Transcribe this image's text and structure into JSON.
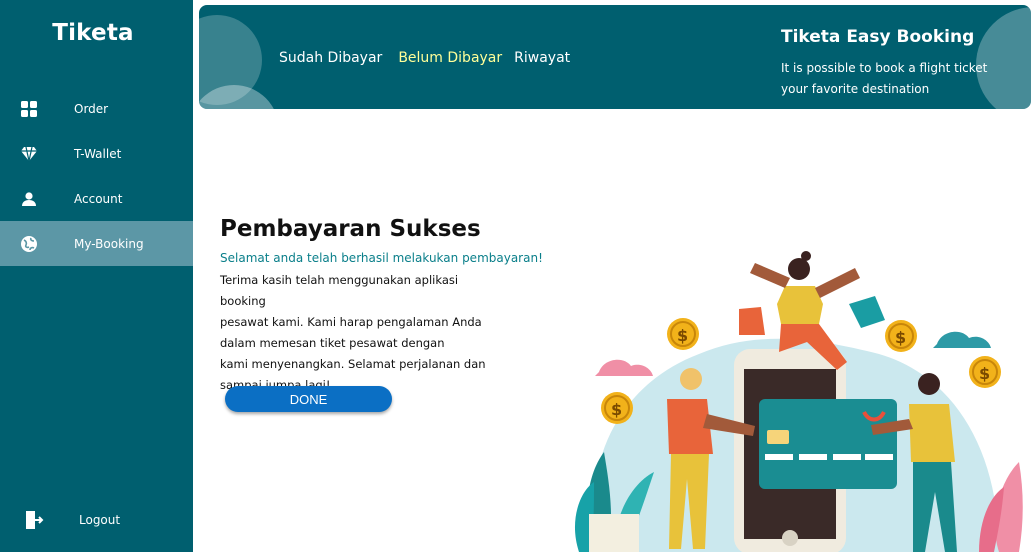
{
  "app": {
    "brand": "Tiketa"
  },
  "sidebar": {
    "items": [
      {
        "label": "Order",
        "icon": "grid-icon"
      },
      {
        "label": "T-Wallet",
        "icon": "diamond-icon"
      },
      {
        "label": "Account",
        "icon": "user-icon"
      },
      {
        "label": "My-Booking",
        "icon": "globe-icon"
      }
    ],
    "active": "My-Booking",
    "logout": {
      "label": "Logout",
      "icon": "logout-icon"
    }
  },
  "header": {
    "tabs": [
      {
        "label": "Sudah Dibayar"
      },
      {
        "label": "Belum Dibayar"
      },
      {
        "label": "Riwayat"
      }
    ],
    "active_tab": "Belum Dibayar",
    "promo_title": "Tiketa Easy Booking",
    "promo_text": "It is possible to book a flight ticket your favorite destination"
  },
  "main": {
    "title": "Pembayaran Sukses",
    "subtitle": "Selamat anda telah berhasil melakukan pembayaran!",
    "body_lines": [
      "Terima kasih telah menggunakan aplikasi booking",
      "pesawat kami. Kami harap pengalaman Anda",
      "dalam memesan tiket pesawat dengan",
      "kami menyenangkan. Selamat perjalanan dan",
      "sampai jumpa lagi!"
    ],
    "done_label": "DONE"
  },
  "colors": {
    "primary": "#005f6f",
    "sidebar_active": "#5c97a6",
    "active_tab": "#ffff99",
    "subtitle": "#0a7f8a",
    "button": "#0b6fc4"
  }
}
